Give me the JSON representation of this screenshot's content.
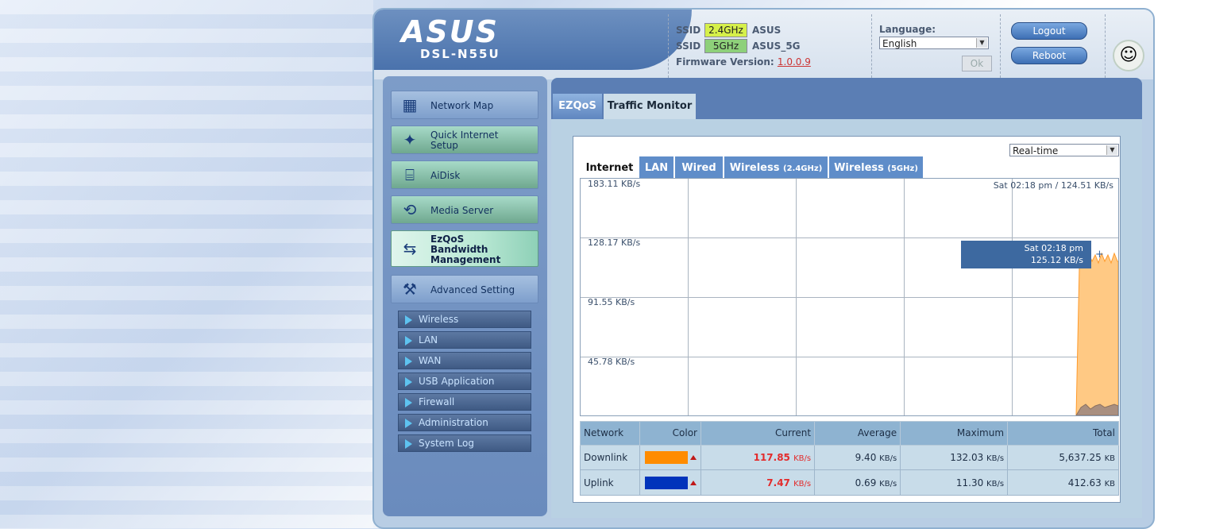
{
  "brand": {
    "logo": "ASUS",
    "model": "DSL-N55U"
  },
  "wireless": {
    "ssid_label": "SSID",
    "band_24": "2.4GHz",
    "name_24": "ASUS",
    "band_5": "5GHz",
    "name_5": "ASUS_5G",
    "firmware_label": "Firmware Version:",
    "firmware_version": "1.0.0.9"
  },
  "language": {
    "label": "Language:",
    "selected": "English",
    "ok_label": "Ok"
  },
  "actions": {
    "logout": "Logout",
    "reboot": "Reboot"
  },
  "sidebar": {
    "items": [
      {
        "label": "Network Map",
        "icon": "network-map-icon"
      },
      {
        "label": "Quick Internet Setup",
        "icon": "magic-wand-icon"
      },
      {
        "label": "AiDisk",
        "icon": "disk-icon"
      },
      {
        "label": "Media Server",
        "icon": "media-server-icon"
      },
      {
        "label": "EzQoS Bandwidth Management",
        "icon": "bandwidth-icon"
      },
      {
        "label": "Advanced Setting",
        "icon": "tools-icon"
      }
    ],
    "sub_items": [
      "Wireless",
      "LAN",
      "WAN",
      "USB Application",
      "Firewall",
      "Administration",
      "System Log"
    ]
  },
  "tabs": {
    "ezqos": "EZQoS",
    "traffic_monitor": "Traffic Monitor"
  },
  "monitor": {
    "range_selected": "Real-time",
    "network_tabs": {
      "internet": "Internet",
      "lan": "LAN",
      "wired": "Wired",
      "wireless_24": "Wireless",
      "wireless_24_sub": "(2.4GHz)",
      "wireless_5": "Wireless",
      "wireless_5_sub": "(5GHz)"
    },
    "y_labels": [
      "183.11 KB/s",
      "128.17 KB/s",
      "91.55 KB/s",
      "45.78 KB/s"
    ],
    "peak_label": "Sat 02:18 pm / 124.51 KB/s",
    "tooltip": {
      "time": "Sat 02:18 pm",
      "value": "125.12 KB/s"
    },
    "colors": {
      "downlink": "#ff8c00",
      "uplink": "#0033bb",
      "downlink_fill": "#ffc984",
      "uplink_fill": "#a98f80"
    }
  },
  "stats": {
    "headers": [
      "Network",
      "Color",
      "Current",
      "Average",
      "Maximum",
      "Total"
    ],
    "rows": [
      {
        "network": "Downlink",
        "current": "117.85",
        "current_unit": "KB/s",
        "average": "9.40",
        "average_unit": "KB/s",
        "maximum": "132.03",
        "maximum_unit": "KB/s",
        "total": "5,637.25",
        "total_unit": "KB"
      },
      {
        "network": "Uplink",
        "current": "7.47",
        "current_unit": "KB/s",
        "average": "0.69",
        "average_unit": "KB/s",
        "maximum": "11.30",
        "maximum_unit": "KB/s",
        "total": "412.63",
        "total_unit": "KB"
      }
    ]
  }
}
